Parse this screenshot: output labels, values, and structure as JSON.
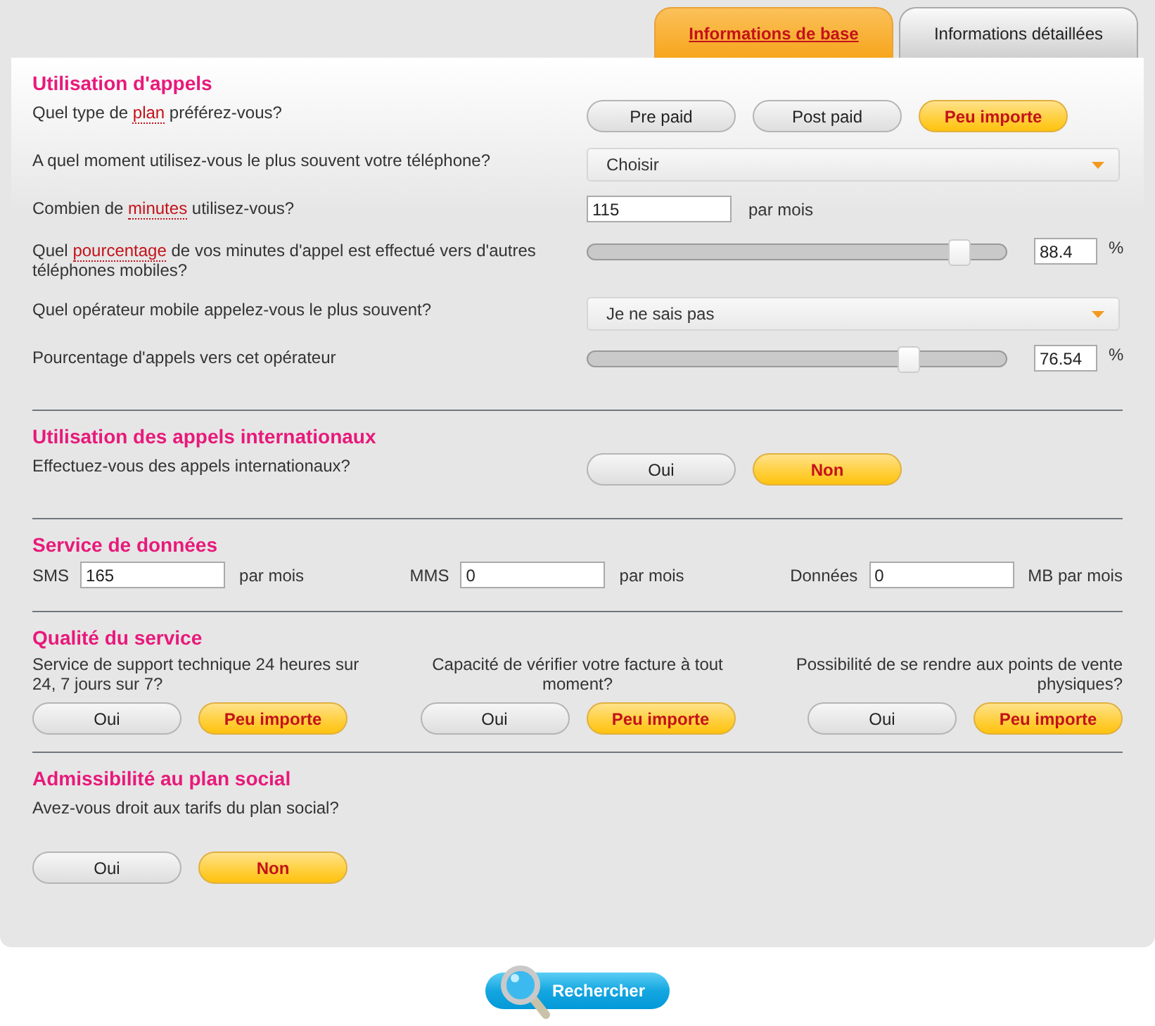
{
  "tabs": [
    {
      "label": "Informations de base",
      "selected": true
    },
    {
      "label": "Informations détaillées",
      "selected": false
    }
  ],
  "sections": [
    {
      "title": "Utilisation d'appels",
      "kind": "rows",
      "items": [
        {
          "kind": "choice",
          "label": [
            {
              "text": "Quel type de "
            },
            {
              "text": "plan",
              "link": true
            },
            {
              "text": " préférez-vous?"
            }
          ],
          "options": [
            {
              "label": "Pre paid",
              "selected": false
            },
            {
              "label": "Post paid",
              "selected": false
            },
            {
              "label": "Peu importe",
              "selected": true
            }
          ]
        },
        {
          "kind": "select",
          "label": [
            {
              "text": "A quel moment utilisez-vous le plus souvent votre téléphone?"
            }
          ],
          "value": "Choisir"
        },
        {
          "kind": "number",
          "label": [
            {
              "text": "Combien de "
            },
            {
              "text": "minutes",
              "link": true
            },
            {
              "text": " utilisez-vous?"
            }
          ],
          "value": "115",
          "unit": "par mois"
        },
        {
          "kind": "slider",
          "label": [
            {
              "text": "Quel "
            },
            {
              "text": "pourcentage",
              "link": true
            },
            {
              "text": " de vos minutes d'appel est effectué vers d'autres téléphones mobiles?"
            }
          ],
          "level": 0.884,
          "value": "88.4",
          "unit": "%"
        },
        {
          "kind": "select",
          "label": [
            {
              "text": "Quel opérateur mobile appelez-vous le plus souvent?"
            }
          ],
          "value": "Je ne sais pas"
        },
        {
          "kind": "slider",
          "label": [
            {
              "text": "Pourcentage d'appels vers cet opérateur"
            }
          ],
          "level": 0.7654,
          "value": "76.54",
          "unit": "%"
        }
      ]
    },
    {
      "title": "Utilisation des appels internationaux",
      "kind": "rows",
      "items": [
        {
          "kind": "choice",
          "label": [
            {
              "text": "Effectuez-vous des appels internationaux?"
            }
          ],
          "options": [
            {
              "label": "Oui",
              "selected": false
            },
            {
              "label": "Non",
              "selected": true
            }
          ]
        }
      ]
    },
    {
      "title": "Service de données",
      "kind": "quantities",
      "fields": [
        {
          "label": "SMS",
          "value": "165",
          "unit": "par mois"
        },
        {
          "label": "MMS",
          "value": "0",
          "unit": "par mois"
        },
        {
          "label": "Données",
          "value": "0",
          "unit": "MB par mois"
        }
      ]
    },
    {
      "title": "Qualité du service",
      "kind": "columns",
      "columns": [
        {
          "label": "Service de support technique 24 heures sur 24, 7 jours sur 7?",
          "options": [
            {
              "label": "Oui",
              "selected": false
            },
            {
              "label": "Peu importe",
              "selected": true
            }
          ]
        },
        {
          "label": "Capacité de vérifier votre facture à tout moment?",
          "options": [
            {
              "label": "Oui",
              "selected": false
            },
            {
              "label": "Peu importe",
              "selected": true
            }
          ]
        },
        {
          "label": "Possibilité de se rendre aux points de vente physiques?",
          "options": [
            {
              "label": "Oui",
              "selected": false
            },
            {
              "label": "Peu importe",
              "selected": true
            }
          ]
        }
      ]
    },
    {
      "title": "Admissibilité au plan social",
      "kind": "stacked",
      "label": "Avez-vous droit aux tarifs du plan social?",
      "options": [
        {
          "label": "Oui",
          "selected": false
        },
        {
          "label": "Non",
          "selected": true
        }
      ]
    }
  ],
  "search_button": "Rechercher"
}
